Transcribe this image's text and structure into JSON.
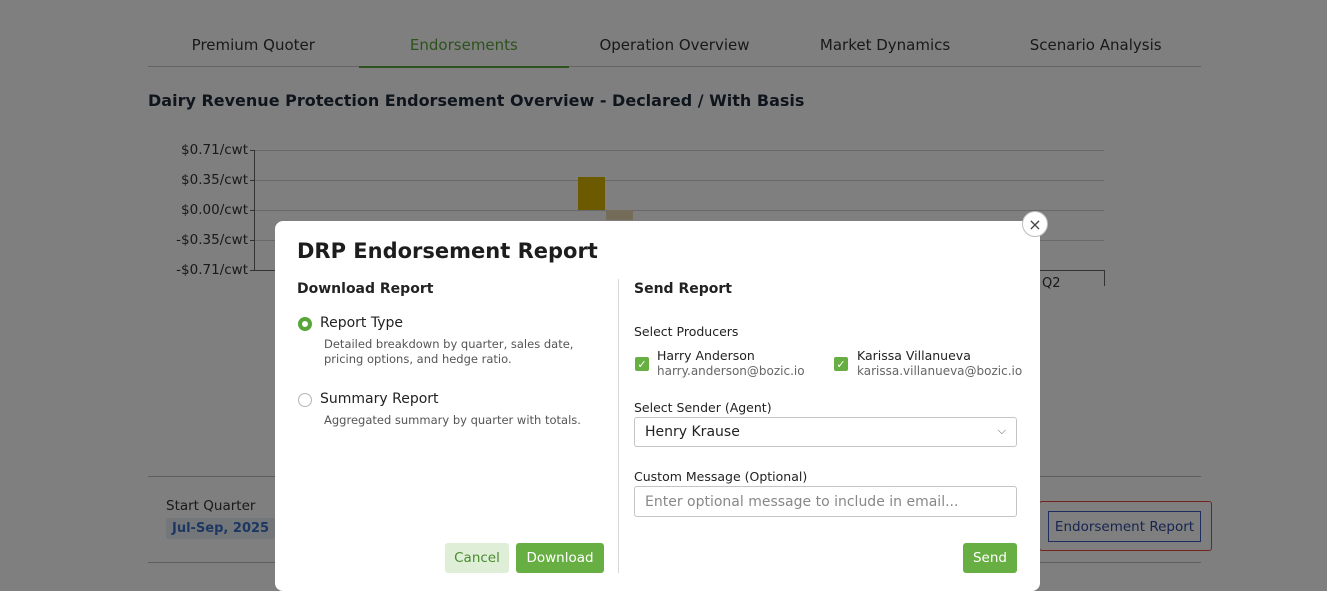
{
  "tabs": [
    {
      "label": "Premium Quoter"
    },
    {
      "label": "Endorsements"
    },
    {
      "label": "Operation Overview"
    },
    {
      "label": "Market Dynamics"
    },
    {
      "label": "Scenario Analysis"
    }
  ],
  "page_title": "Dairy Revenue Protection Endorsement Overview - Declared / With Basis",
  "chart": {
    "y_ticks": [
      "$0.71/cwt",
      "$0.35/cwt",
      "$0.00/cwt",
      "-$0.35/cwt",
      "-$0.71/cwt"
    ],
    "x_label_visible": "Q2"
  },
  "start_quarter": {
    "label": "Start Quarter",
    "value": "Jul-Sep, 2025"
  },
  "endorsement_report_button": "Endorsement Report",
  "modal": {
    "title": "DRP Endorsement Report",
    "close_icon": "×",
    "download": {
      "title": "Download Report",
      "options": [
        {
          "label": "Report Type",
          "desc": "Detailed breakdown by quarter, sales date, pricing options, and hedge ratio.",
          "selected": true
        },
        {
          "label": "Summary Report",
          "desc": "Aggregated summary by quarter with totals.",
          "selected": false
        }
      ],
      "cancel_label": "Cancel",
      "download_label": "Download"
    },
    "send": {
      "title": "Send Report",
      "producers_label": "Select Producers",
      "producers": [
        {
          "name": "Harry Anderson",
          "email": "harry.anderson@bozic.io",
          "checked": true
        },
        {
          "name": "Karissa Villanueva",
          "email": "karissa.villanueva@bozic.io",
          "checked": true
        }
      ],
      "sender_label": "Select Sender (Agent)",
      "sender_value": "Henry Krause",
      "message_label": "Custom Message (Optional)",
      "message_placeholder": "Enter optional message to include in email...",
      "send_label": "Send"
    }
  },
  "colors": {
    "accent_green": "#67af42",
    "bar_yellow": "#d8b400",
    "bar_light": "#e8d9b0",
    "highlight_red": "#e5483f"
  }
}
